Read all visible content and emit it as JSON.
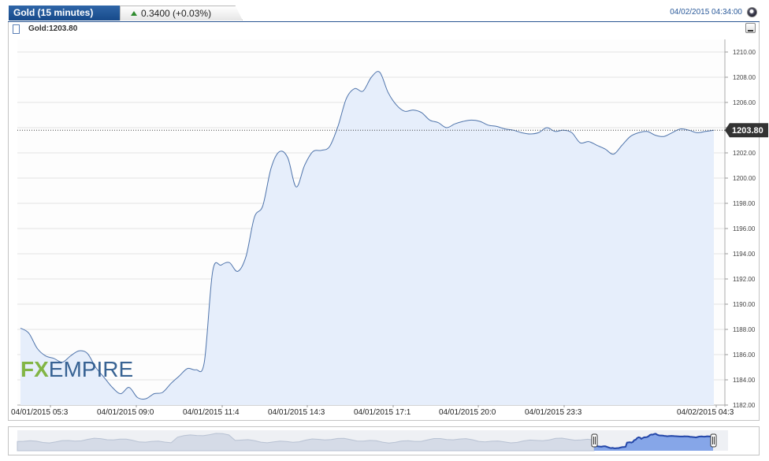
{
  "header": {
    "title": "Gold (15 minutes)",
    "change": "0.3400 (+0.03%)",
    "timestamp": "04/02/2015 04:34:00"
  },
  "legend": {
    "label": "Gold:1203.80"
  },
  "colors": {
    "line": "#4f74ab",
    "fill": "#e6eefb",
    "tab_blue": "#1f55a0",
    "up_arrow": "#2e8b2e",
    "price_tag": "#333333",
    "watermark_fx": "#7db33c",
    "watermark_empire": "#2e5b8e"
  },
  "watermark": {
    "fx": "FX",
    "empire": "EMPIRE"
  },
  "price_tag": "1203.80",
  "chart_data": {
    "type": "area",
    "title": "Gold (15 minutes)",
    "ylim": [
      1182,
      1211
    ],
    "y_ticks": [
      "1182.00",
      "1184.00",
      "1186.00",
      "1188.00",
      "1190.00",
      "1192.00",
      "1194.00",
      "1196.00",
      "1198.00",
      "1200.00",
      "1202.00",
      "1204.00",
      "1206.00",
      "1208.00",
      "1210.00"
    ],
    "x_tick_labels": [
      "04/01/2015 05:3",
      "04/01/2015 09:0",
      "04/01/2015 11:4",
      "04/01/2015 14:3",
      "04/01/2015 17:1",
      "04/01/2015 20:0",
      "04/01/2015 23:3",
      "04/02/2015 04:3"
    ],
    "last_value": 1203.8,
    "grid": true,
    "series": [
      {
        "name": "Gold",
        "values": [
          1188.1,
          1187.7,
          1186.5,
          1185.9,
          1185.7,
          1185.4,
          1185.9,
          1186.3,
          1186.1,
          1185.0,
          1184.2,
          1183.4,
          1182.9,
          1183.4,
          1182.6,
          1182.5,
          1182.9,
          1183.0,
          1183.7,
          1184.3,
          1184.9,
          1184.8,
          1185.4,
          1192.6,
          1193.1,
          1193.3,
          1192.6,
          1193.8,
          1196.9,
          1197.8,
          1200.8,
          1202.1,
          1201.6,
          1199.3,
          1201.0,
          1202.1,
          1202.2,
          1202.5,
          1204.1,
          1206.3,
          1207.1,
          1206.9,
          1208.0,
          1208.4,
          1206.8,
          1205.8,
          1205.3,
          1205.4,
          1205.2,
          1204.6,
          1204.4,
          1204.0,
          1204.3,
          1204.5,
          1204.6,
          1204.5,
          1204.2,
          1204.1,
          1203.9,
          1203.8,
          1203.6,
          1203.5,
          1203.6,
          1204.0,
          1203.7,
          1203.8,
          1203.6,
          1202.8,
          1202.9,
          1202.6,
          1202.3,
          1201.9,
          1202.6,
          1203.3,
          1203.6,
          1203.7,
          1203.4,
          1203.3,
          1203.6,
          1203.9,
          1203.8,
          1203.6,
          1203.7,
          1203.8
        ]
      }
    ]
  }
}
